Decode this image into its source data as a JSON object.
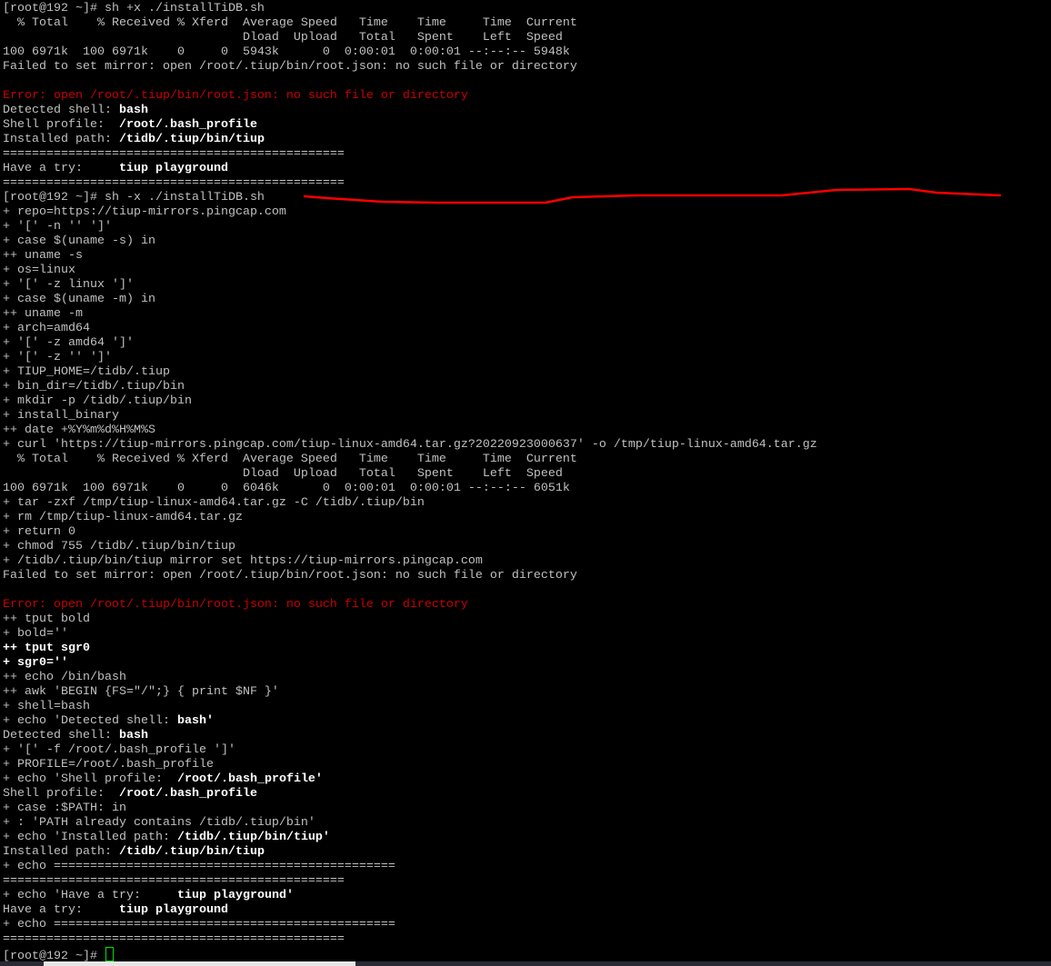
{
  "colors": {
    "text": "#c0c0c0",
    "bold": "#ffffff",
    "error": "#c80000",
    "annotation": "#ff0000",
    "cursor": "#00e000"
  },
  "lines": [
    [
      [
        "[root@192 ~]# sh +x ./installTiDB.sh",
        "n"
      ]
    ],
    [
      [
        "  % Total    % Received % Xferd  Average Speed   Time    Time     Time  Current",
        "n"
      ]
    ],
    [
      [
        "                                 Dload  Upload   Total   Spent    Left  Speed",
        "n"
      ]
    ],
    [
      [
        "100 6971k  100 6971k    0     0  5943k      0  0:00:01  0:00:01 --:--:-- 5948k",
        "n"
      ]
    ],
    [
      [
        "Failed to set mirror: open /root/.tiup/bin/root.json: no such file or directory",
        "n"
      ]
    ],
    [
      [
        "",
        "n"
      ]
    ],
    [
      [
        "Error: open /root/.tiup/bin/root.json: no such file or directory",
        "r"
      ]
    ],
    [
      [
        "Detected shell: ",
        "n"
      ],
      [
        "bash",
        "b"
      ]
    ],
    [
      [
        "Shell profile:  ",
        "n"
      ],
      [
        "/root/.bash_profile",
        "b"
      ]
    ],
    [
      [
        "Installed path: ",
        "n"
      ],
      [
        "/tidb/.tiup/bin/tiup",
        "b"
      ]
    ],
    [
      [
        "===============================================",
        "n"
      ]
    ],
    [
      [
        "Have a try:     ",
        "n"
      ],
      [
        "tiup playground",
        "b"
      ]
    ],
    [
      [
        "===============================================",
        "n"
      ]
    ],
    [
      [
        "[root@192 ~]# sh -x ./installTiDB.sh",
        "n"
      ]
    ],
    [
      [
        "+ repo=https://tiup-mirrors.pingcap.com",
        "n"
      ]
    ],
    [
      [
        "+ '[' -n '' ']'",
        "n"
      ]
    ],
    [
      [
        "+ case $(uname -s) in",
        "n"
      ]
    ],
    [
      [
        "++ uname -s",
        "n"
      ]
    ],
    [
      [
        "+ os=linux",
        "n"
      ]
    ],
    [
      [
        "+ '[' -z linux ']'",
        "n"
      ]
    ],
    [
      [
        "+ case $(uname -m) in",
        "n"
      ]
    ],
    [
      [
        "++ uname -m",
        "n"
      ]
    ],
    [
      [
        "+ arch=amd64",
        "n"
      ]
    ],
    [
      [
        "+ '[' -z amd64 ']'",
        "n"
      ]
    ],
    [
      [
        "+ '[' -z '' ']'",
        "n"
      ]
    ],
    [
      [
        "+ TIUP_HOME=/tidb/.tiup",
        "n"
      ]
    ],
    [
      [
        "+ bin_dir=/tidb/.tiup/bin",
        "n"
      ]
    ],
    [
      [
        "+ mkdir -p /tidb/.tiup/bin",
        "n"
      ]
    ],
    [
      [
        "+ install_binary",
        "n"
      ]
    ],
    [
      [
        "++ date +%Y%m%d%H%M%S",
        "n"
      ]
    ],
    [
      [
        "+ curl 'https://tiup-mirrors.pingcap.com/tiup-linux-amd64.tar.gz?20220923000637' -o /tmp/tiup-linux-amd64.tar.gz",
        "n"
      ]
    ],
    [
      [
        "  % Total    % Received % Xferd  Average Speed   Time    Time     Time  Current",
        "n"
      ]
    ],
    [
      [
        "                                 Dload  Upload   Total   Spent    Left  Speed",
        "n"
      ]
    ],
    [
      [
        "100 6971k  100 6971k    0     0  6046k      0  0:00:01  0:00:01 --:--:-- 6051k",
        "n"
      ]
    ],
    [
      [
        "+ tar -zxf /tmp/tiup-linux-amd64.tar.gz -C /tidb/.tiup/bin",
        "n"
      ]
    ],
    [
      [
        "+ rm /tmp/tiup-linux-amd64.tar.gz",
        "n"
      ]
    ],
    [
      [
        "+ return 0",
        "n"
      ]
    ],
    [
      [
        "+ chmod 755 /tidb/.tiup/bin/tiup",
        "n"
      ]
    ],
    [
      [
        "+ /tidb/.tiup/bin/tiup mirror set https://tiup-mirrors.pingcap.com",
        "n"
      ]
    ],
    [
      [
        "Failed to set mirror: open /root/.tiup/bin/root.json: no such file or directory",
        "n"
      ]
    ],
    [
      [
        "",
        "n"
      ]
    ],
    [
      [
        "Error: open /root/.tiup/bin/root.json: no such file or directory",
        "r"
      ]
    ],
    [
      [
        "++ tput bold",
        "n"
      ]
    ],
    [
      [
        "+ bold=''",
        "n"
      ]
    ],
    [
      [
        "++ tput sgr0",
        "b"
      ]
    ],
    [
      [
        "+ sgr0=''",
        "b"
      ]
    ],
    [
      [
        "++ echo /bin/bash",
        "n"
      ]
    ],
    [
      [
        "++ awk 'BEGIN {FS=\"/\";} { print $NF }'",
        "n"
      ]
    ],
    [
      [
        "+ shell=bash",
        "n"
      ]
    ],
    [
      [
        "+ echo 'Detected shell: ",
        "n"
      ],
      [
        "bash'",
        "b"
      ]
    ],
    [
      [
        "Detected shell: ",
        "n"
      ],
      [
        "bash",
        "b"
      ]
    ],
    [
      [
        "+ '[' -f /root/.bash_profile ']'",
        "n"
      ]
    ],
    [
      [
        "+ PROFILE=/root/.bash_profile",
        "n"
      ]
    ],
    [
      [
        "+ echo 'Shell profile:  ",
        "n"
      ],
      [
        "/root/.bash_profile'",
        "b"
      ]
    ],
    [
      [
        "Shell profile:  ",
        "n"
      ],
      [
        "/root/.bash_profile",
        "b"
      ]
    ],
    [
      [
        "+ case :$PATH: in",
        "n"
      ]
    ],
    [
      [
        "+ : 'PATH already contains /tidb/.tiup/bin'",
        "n"
      ]
    ],
    [
      [
        "+ echo 'Installed path: ",
        "n"
      ],
      [
        "/tidb/.tiup/bin/tiup'",
        "b"
      ]
    ],
    [
      [
        "Installed path: ",
        "n"
      ],
      [
        "/tidb/.tiup/bin/tiup",
        "b"
      ]
    ],
    [
      [
        "+ echo ===============================================",
        "n"
      ]
    ],
    [
      [
        "===============================================",
        "n"
      ]
    ],
    [
      [
        "+ echo 'Have a try:     ",
        "n"
      ],
      [
        "tiup playground'",
        "b"
      ]
    ],
    [
      [
        "Have a try:     ",
        "n"
      ],
      [
        "tiup playground",
        "b"
      ]
    ],
    [
      [
        "+ echo ===============================================",
        "n"
      ]
    ],
    [
      [
        "===============================================",
        "n"
      ]
    ]
  ],
  "prompt": "[root@192 ~]# "
}
